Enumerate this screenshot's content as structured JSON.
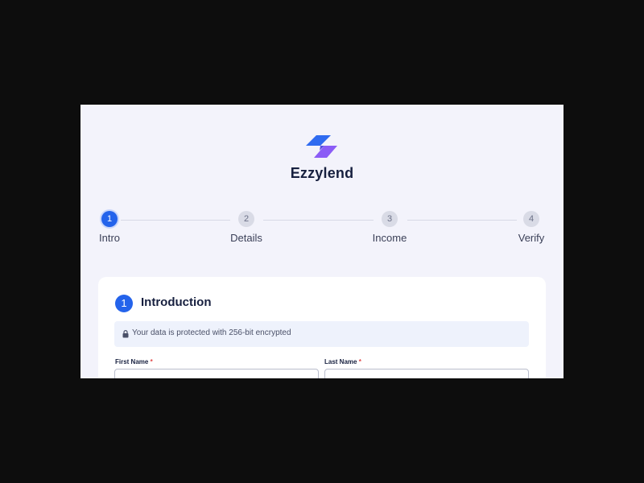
{
  "brand": {
    "name": "Ezzylend",
    "colors": {
      "primary": "#2463eb",
      "secondary": "#8b5cf6"
    }
  },
  "stepper": {
    "steps": [
      {
        "number": "1",
        "label": "Intro",
        "active": true
      },
      {
        "number": "2",
        "label": "Details",
        "active": false
      },
      {
        "number": "3",
        "label": "Income",
        "active": false
      },
      {
        "number": "4",
        "label": "Verify",
        "active": false
      }
    ]
  },
  "card": {
    "number": "1",
    "title": "Introduction",
    "notice": {
      "icon": "lock-icon",
      "text": "Your data is protected with 256-bit encrypted"
    },
    "fields": {
      "first_name": {
        "label": "First Name",
        "required_mark": "*",
        "value": ""
      },
      "last_name": {
        "label": "Last Name",
        "required_mark": "*",
        "value": ""
      }
    }
  }
}
